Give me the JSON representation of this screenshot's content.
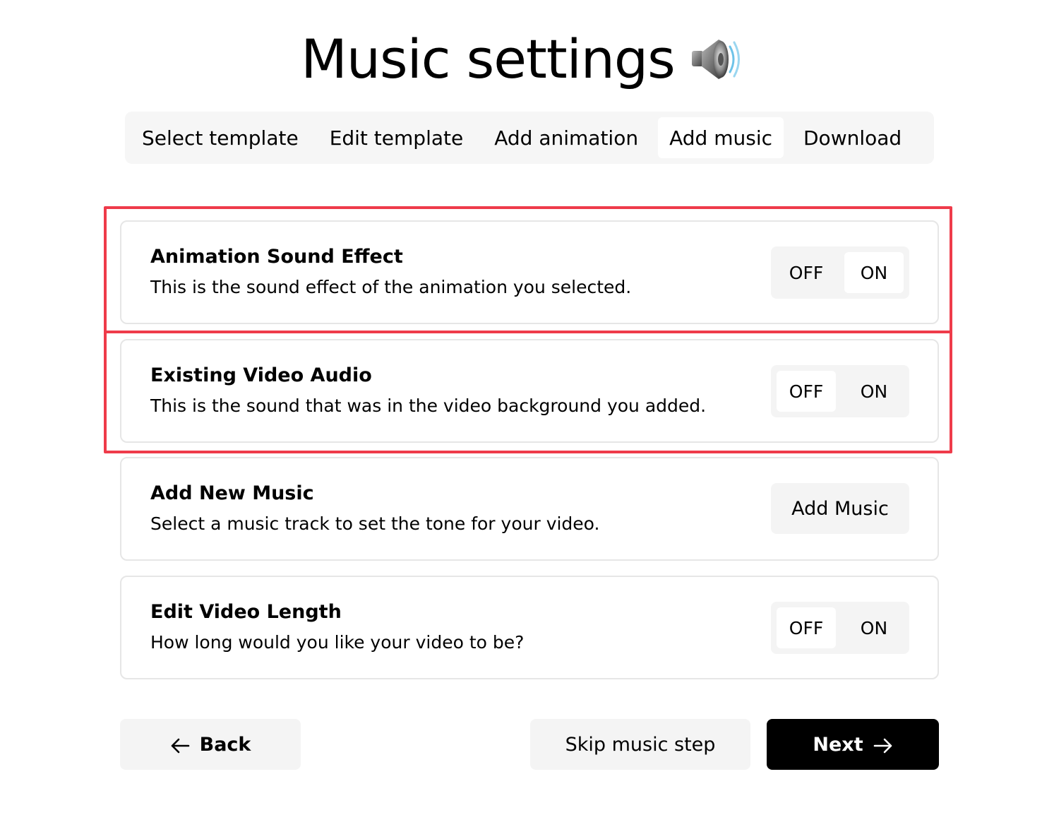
{
  "header": {
    "title": "Music settings",
    "icon": "speaker-icon"
  },
  "steps": [
    {
      "label": "Select template",
      "active": false
    },
    {
      "label": "Edit template",
      "active": false
    },
    {
      "label": "Add animation",
      "active": false
    },
    {
      "label": "Add music",
      "active": true
    },
    {
      "label": "Download",
      "active": false
    }
  ],
  "settings": {
    "animation_sound": {
      "title": "Animation Sound Effect",
      "description": "This is the sound effect of the animation you selected.",
      "off_label": "OFF",
      "on_label": "ON",
      "selected": "ON"
    },
    "video_audio": {
      "title": "Existing Video Audio",
      "description": "This is the sound that was in the video background you added.",
      "off_label": "OFF",
      "on_label": "ON",
      "selected": "OFF"
    },
    "new_music": {
      "title": "Add New Music",
      "description": "Select a music track to set the tone for your video.",
      "button_label": "Add Music"
    },
    "video_length": {
      "title": "Edit Video Length",
      "description": "How long would you like your video to be?",
      "off_label": "OFF",
      "on_label": "ON",
      "selected": "OFF"
    }
  },
  "footer": {
    "back_label": "Back",
    "skip_label": "Skip music step",
    "next_label": "Next"
  },
  "colors": {
    "highlight": "#ef3b4a",
    "primary": "#000000",
    "surface": "#f4f4f4"
  }
}
